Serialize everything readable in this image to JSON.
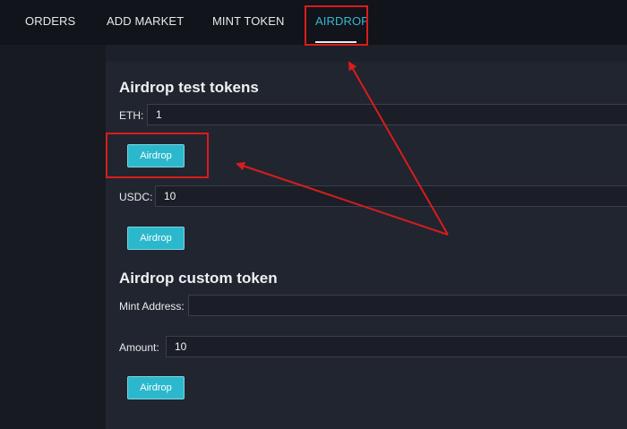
{
  "nav": {
    "items": [
      {
        "label": "ORDERS"
      },
      {
        "label": "ADD MARKET"
      },
      {
        "label": "MINT TOKEN"
      },
      {
        "label": "AIRDROP"
      }
    ],
    "active": "AIRDROP"
  },
  "test_tokens": {
    "title": "Airdrop test tokens",
    "eth_label": "ETH:",
    "eth_value": "1",
    "eth_button": "Airdrop",
    "usdc_label": "USDC:",
    "usdc_value": "10",
    "usdc_button": "Airdrop"
  },
  "custom_token": {
    "title": "Airdrop custom token",
    "mint_label": "Mint Address:",
    "mint_value": "",
    "amount_label": "Amount:",
    "amount_value": "10",
    "button": "Airdrop"
  },
  "colors": {
    "accent": "#2bb8cc",
    "annotation": "#d91c1c"
  }
}
